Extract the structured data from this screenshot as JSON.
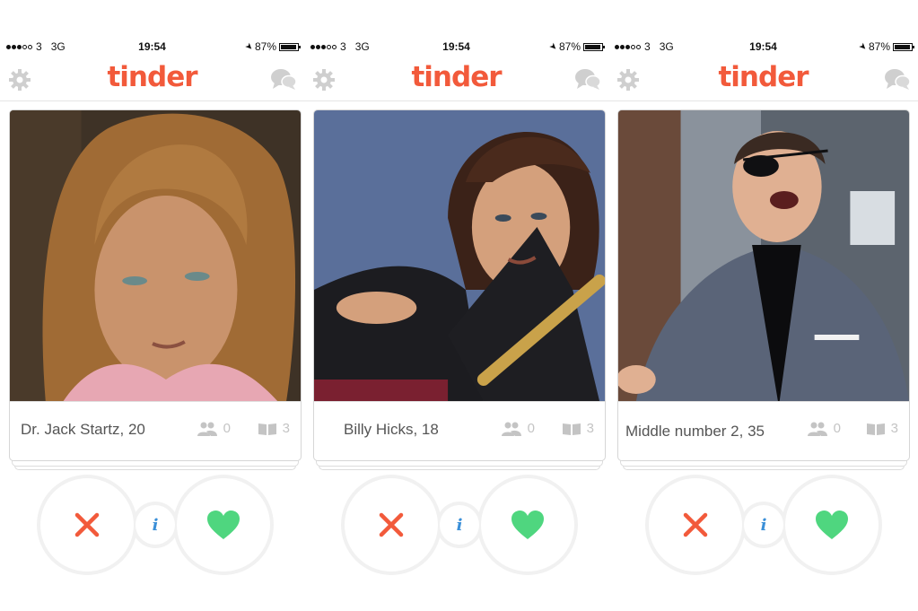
{
  "status": {
    "carrier_num": "3",
    "network": "3G",
    "time": "19:54",
    "battery": "87%",
    "battery_level": 0.87
  },
  "app": {
    "logo": "tinder"
  },
  "icons": {
    "settings": "gear-icon",
    "messages": "chat-bubbles-icon",
    "friends": "people-icon",
    "interests": "book-icon",
    "nope": "x-icon",
    "info": "info-icon",
    "like": "heart-icon"
  },
  "colors": {
    "brand": "#f25a3b",
    "nope": "#f25a3b",
    "like": "#4fd67f",
    "info": "#3a8fd8"
  },
  "screens": [
    {
      "name": "Dr. Jack Startz, 20",
      "friends": "0",
      "interests": "3",
      "info": "i"
    },
    {
      "name": "Billy Hicks, 18",
      "friends": "0",
      "interests": "3",
      "info": "i"
    },
    {
      "name": "Middle number 2, 35",
      "friends": "0",
      "interests": "3",
      "info": "i"
    }
  ]
}
